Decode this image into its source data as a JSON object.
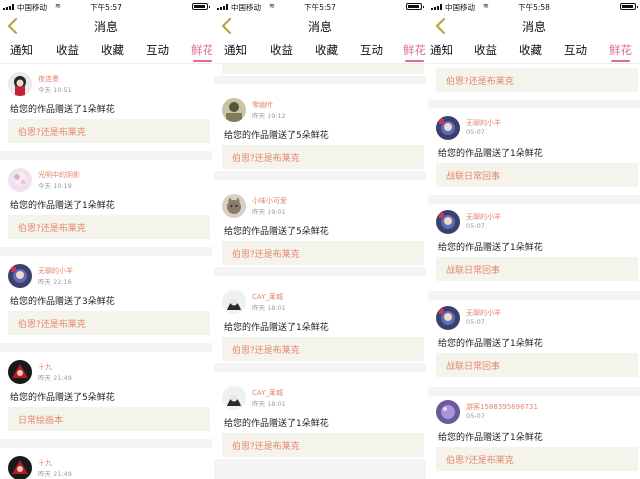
{
  "colors": {
    "accent": "#e06a9b",
    "name": "#e5866b",
    "time": "#9a9a9a",
    "work_bg": "#f5f4ec"
  },
  "panels": [
    {
      "status": {
        "carrier": "中国移动",
        "time": "下午5:57"
      },
      "title": "消息",
      "tabs": [
        "通知",
        "收益",
        "收藏",
        "互动",
        "鲜花"
      ],
      "active_tab": "鲜花",
      "items": [
        {
          "name": "夜连墨",
          "time": "今天 10:51",
          "message": "给您的作品赠送了1朵鲜花",
          "work": "伯恩?还是布莱克",
          "avatar": "avatar-bw"
        },
        {
          "name": "光明中的阴影",
          "time": "今天 10:19",
          "message": "给您的作品赠送了1朵鲜花",
          "work": "伯恩?还是布莱克",
          "avatar": "avatar-pink"
        },
        {
          "name": "无聊的小羊",
          "time": "昨天 22:16",
          "message": "给您的作品赠送了3朵鲜花",
          "work": "伯恩?还是布莱克",
          "avatar": "avatar-anime"
        },
        {
          "name": "十九",
          "time": "昨天 21:49",
          "message": "给您的作品赠送了5朵鲜花",
          "work": "日常绘画本",
          "avatar": "avatar-red"
        },
        {
          "name": "十九",
          "time": "昨天 21:49",
          "message": "",
          "work": "",
          "avatar": "avatar-red"
        }
      ]
    },
    {
      "status": {
        "carrier": "中国移动",
        "time": "下午5:57"
      },
      "title": "消息",
      "tabs": [
        "通知",
        "收益",
        "收藏",
        "互动",
        "鲜花"
      ],
      "active_tab": "鲜花",
      "items": [
        {
          "name": "",
          "time": "",
          "message": "",
          "work": "",
          "avatar": ""
        },
        {
          "name": "零幽叶",
          "time": "昨天 19:12",
          "message": "给您的作品赠送了5朵鲜花",
          "work": "伯恩?还是布莱克",
          "avatar": "avatar-photo"
        },
        {
          "name": "小味小可爱",
          "time": "昨天 19:01",
          "message": "给您的作品赠送了5朵鲜花",
          "work": "伯恩?还是布莱克",
          "avatar": "avatar-cat"
        },
        {
          "name": "CAY_莱城",
          "time": "昨天 18:01",
          "message": "给您的作品赠送了1朵鲜花",
          "work": "伯恩?还是布莱克",
          "avatar": "avatar-bw2"
        },
        {
          "name": "CAY_莱城",
          "time": "昨天 18:01",
          "message": "给您的作品赠送了1朵鲜花",
          "work": "伯恩?还是布莱克",
          "avatar": "avatar-bw2"
        }
      ]
    },
    {
      "status": {
        "carrier": "中国移动",
        "time": "下午5:58"
      },
      "title": "消息",
      "tabs": [
        "通知",
        "收益",
        "收藏",
        "互动",
        "鲜花"
      ],
      "active_tab": "鲜花",
      "items": [
        {
          "name": "",
          "time": "",
          "message": "",
          "work": "伯恩?还是布莱克",
          "avatar": ""
        },
        {
          "name": "无聊的小羊",
          "time": "05-07",
          "message": "给您的作品赠送了1朵鲜花",
          "work": "战联日常回事",
          "avatar": "avatar-anime"
        },
        {
          "name": "无聊的小羊",
          "time": "05-07",
          "message": "给您的作品赠送了1朵鲜花",
          "work": "战联日常回事",
          "avatar": "avatar-anime"
        },
        {
          "name": "无聊的小羊",
          "time": "05-07",
          "message": "给您的作品赠送了1朵鲜花",
          "work": "战联日常回事",
          "avatar": "avatar-anime"
        },
        {
          "name": "游客1588395696731",
          "time": "05-07",
          "message": "给您的作品赠送了1朵鲜花",
          "work": "伯恩?还是布莱克",
          "avatar": "avatar-purple"
        }
      ]
    }
  ]
}
